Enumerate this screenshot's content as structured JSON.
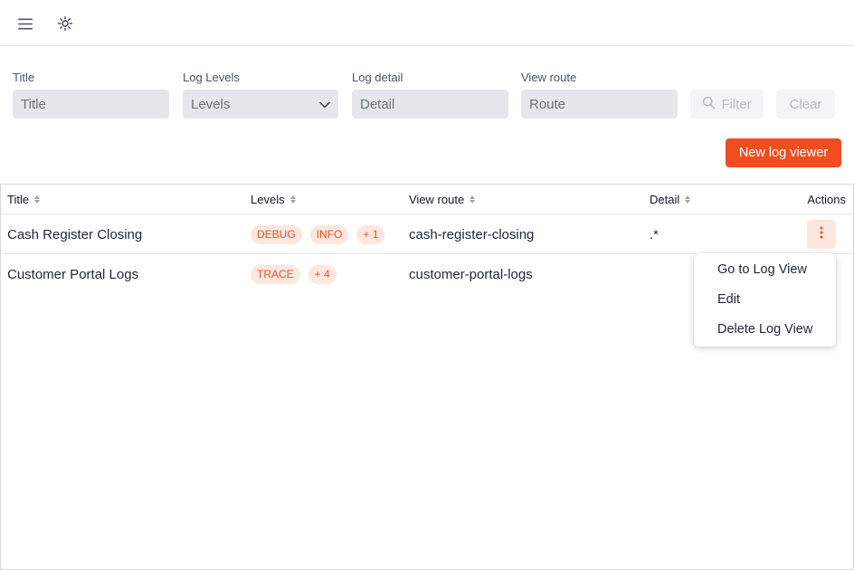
{
  "topbar": {
    "menu_icon": "hamburger-menu-icon",
    "theme_icon": "sun-icon"
  },
  "filters": {
    "title": {
      "label": "Title",
      "placeholder": "Title"
    },
    "levels": {
      "label": "Log Levels",
      "placeholder": "Levels",
      "icon": "chevron-down-icon"
    },
    "detail": {
      "label": "Log detail",
      "placeholder": "Detail"
    },
    "route": {
      "label": "View route",
      "placeholder": "Route"
    },
    "filter_button": "Filter",
    "clear_button": "Clear"
  },
  "toolbar": {
    "new_button": "New log viewer"
  },
  "table": {
    "columns": {
      "title": "Title",
      "levels": "Levels",
      "route": "View route",
      "detail": "Detail",
      "actions": "Actions"
    },
    "rows": [
      {
        "title": "Cash Register Closing",
        "levels": [
          "DEBUG",
          "INFO"
        ],
        "more": "+ 1",
        "route": "cash-register-closing",
        "detail": ".*"
      },
      {
        "title": "Customer Portal Logs",
        "levels": [
          "TRACE"
        ],
        "more": "+ 4",
        "route": "customer-portal-logs",
        "detail": ""
      }
    ]
  },
  "actions_menu": {
    "items": [
      "Go to Log View",
      "Edit",
      "Delete Log View"
    ]
  },
  "colors": {
    "accent": "#f04e1f",
    "tag_bg": "#fde7df",
    "tag_text": "#e8512a",
    "input_bg": "#e5e7eb"
  }
}
